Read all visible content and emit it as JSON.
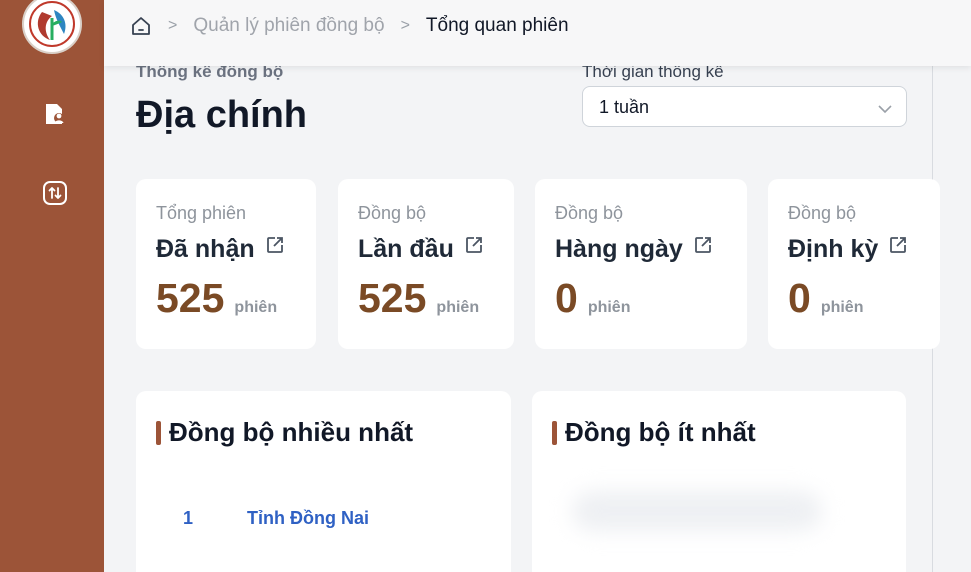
{
  "breadcrumb": {
    "items": [
      "Quản lý phiên đồng bộ",
      "Tổng quan phiên"
    ],
    "separator": ">"
  },
  "page": {
    "kicker": "Thống kê đồng bộ",
    "title": "Địa chính"
  },
  "time_filter": {
    "label": "Thời gian thống kê",
    "value": "1 tuần"
  },
  "stats": [
    {
      "kicker": "Tổng phiên",
      "title": "Đã nhận",
      "value": "525",
      "unit": "phiên"
    },
    {
      "kicker": "Đồng bộ",
      "title": "Lần đầu",
      "value": "525",
      "unit": "phiên"
    },
    {
      "kicker": "Đồng bộ",
      "title": "Hàng ngày",
      "value": "0",
      "unit": "phiên"
    },
    {
      "kicker": "Đồng bộ",
      "title": "Định kỳ",
      "value": "0",
      "unit": "phiên"
    }
  ],
  "most_synced": {
    "title": "Đồng bộ nhiều nhất",
    "rows": [
      {
        "rank": "1",
        "name": "Tỉnh Đồng Nai"
      }
    ]
  },
  "least_synced": {
    "title": "Đồng bộ ít nhất"
  },
  "colors": {
    "sidebar": "#9c5438",
    "accent": "#7a4a25",
    "link": "#2f61c4"
  },
  "icons": {
    "home": "home-icon",
    "sidebar_1": "document-user-icon",
    "sidebar_2": "sync-arrows-icon",
    "external": "external-link-icon",
    "chevron": "chevron-down-icon"
  }
}
